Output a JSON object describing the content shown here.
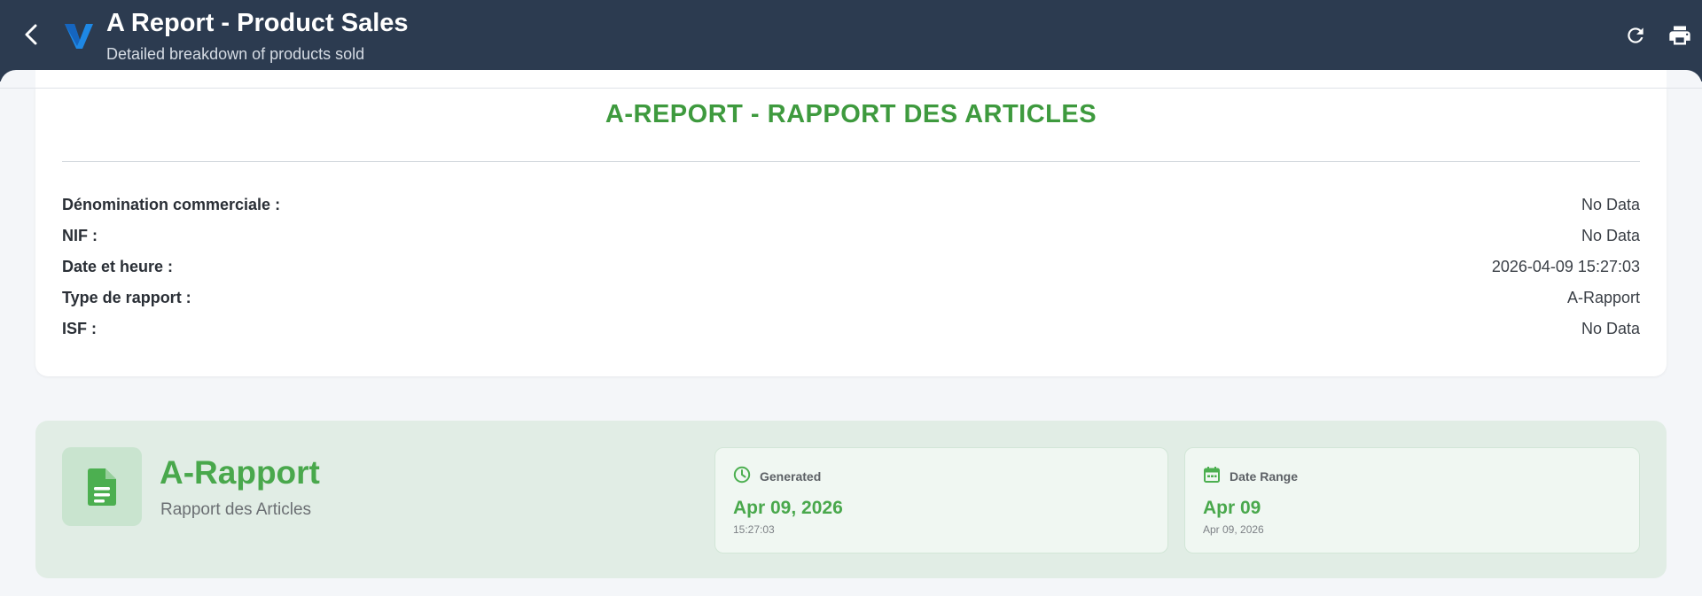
{
  "header": {
    "title": "A Report - Product Sales",
    "subtitle": "Detailed breakdown of products sold",
    "icons": {
      "back": "chevron-left-icon",
      "logo": "v-logo",
      "refresh": "refresh-icon",
      "print": "print-icon"
    }
  },
  "report": {
    "heading": "A-REPORT - RAPPORT DES ARTICLES",
    "rows": [
      {
        "label": "Dénomination commerciale :",
        "value": "No Data"
      },
      {
        "label": "NIF :",
        "value": "No Data"
      },
      {
        "label": "Date et heure :",
        "value": "2026-04-09 15:27:03"
      },
      {
        "label": "Type de rapport :",
        "value": "A-Rapport"
      },
      {
        "label": "ISF :",
        "value": "No Data"
      }
    ]
  },
  "summary": {
    "title": "A-Rapport",
    "subtitle": "Rapport des Articles",
    "icon": "document-icon",
    "generated": {
      "label": "Generated",
      "value": "Apr 09, 2026",
      "sub": "15:27:03",
      "icon": "clock-icon"
    },
    "date_range": {
      "label": "Date Range",
      "value": "Apr 09",
      "sub": "Apr 09, 2026",
      "icon": "calendar-icon"
    }
  },
  "colors": {
    "header_bg": "#2c3b50",
    "accent_green": "#3e9a3e",
    "summary_bg": "#e1ede5",
    "logo_blue": "#1e88e5"
  }
}
